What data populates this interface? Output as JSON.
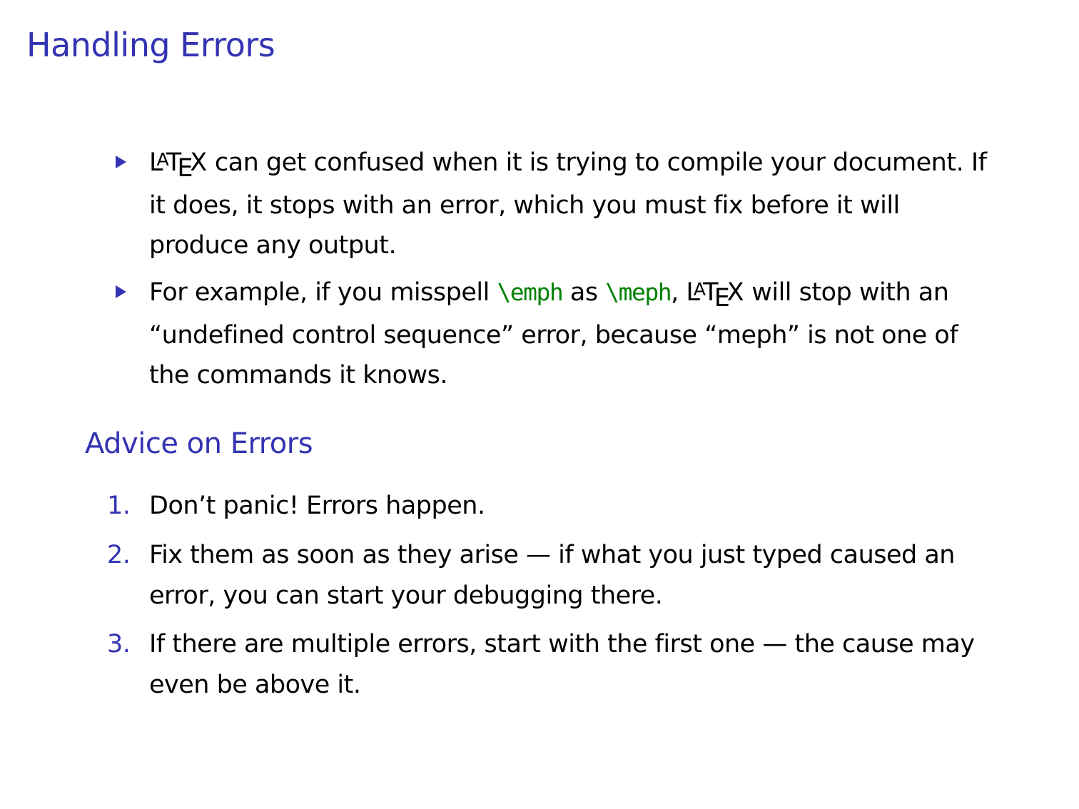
{
  "title": "Handling Errors",
  "bullets": {
    "item1": {
      "latex_word": "LaTeX",
      "text": " can get confused when it is trying to compile your document. If it does, it stops with an error, which you must fix before it will produce any output."
    },
    "item2": {
      "text_before": "For example, if you misspell ",
      "code1": "\\emph",
      "text_mid": " as ",
      "code2": "\\meph",
      "comma": ", ",
      "latex_word": "LaTeX",
      "text_after": " will stop with an “undefined control sequence” error, because “meph” is not one of the commands it knows."
    }
  },
  "advice": {
    "title": "Advice on Errors",
    "items": [
      {
        "number": "1.",
        "text": "Don’t panic! Errors happen."
      },
      {
        "number": "2.",
        "text": "Fix them as soon as they arise — if what you just typed caused an error, you can start your debugging there."
      },
      {
        "number": "3.",
        "text": "If there are multiple errors, start with the first one — the cause may even be above it."
      }
    ]
  },
  "colors": {
    "structure": "#3333B3",
    "code": "#008000",
    "text": "#000000",
    "background": "#FFFFFF"
  },
  "icons": {
    "bullet": "triangle-bullet-icon"
  }
}
